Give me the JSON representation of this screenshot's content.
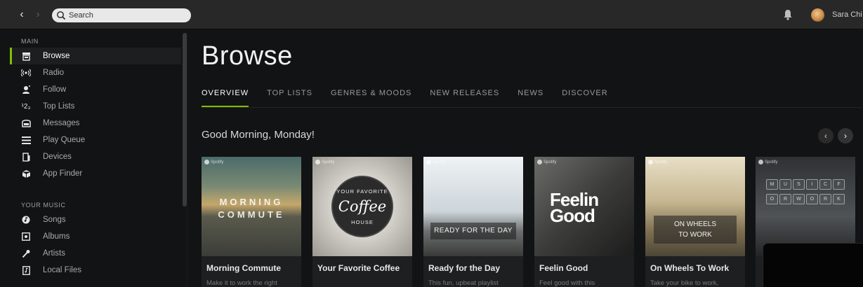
{
  "topbar": {
    "search_placeholder": "Search",
    "user_name": "Sara Chi"
  },
  "sidebar": {
    "main_label": "MAIN",
    "main_items": [
      {
        "label": "Browse",
        "icon": "browse-icon",
        "active": true
      },
      {
        "label": "Radio",
        "icon": "radio-icon"
      },
      {
        "label": "Follow",
        "icon": "follow-icon"
      },
      {
        "label": "Top Lists",
        "icon": "top-lists-icon"
      },
      {
        "label": "Messages",
        "icon": "messages-icon"
      },
      {
        "label": "Play Queue",
        "icon": "play-queue-icon"
      },
      {
        "label": "Devices",
        "icon": "devices-icon"
      },
      {
        "label": "App Finder",
        "icon": "app-finder-icon"
      }
    ],
    "music_label": "YOUR MUSIC",
    "music_items": [
      {
        "label": "Songs",
        "icon": "songs-icon"
      },
      {
        "label": "Albums",
        "icon": "albums-icon"
      },
      {
        "label": "Artists",
        "icon": "artists-icon"
      },
      {
        "label": "Local Files",
        "icon": "local-files-icon"
      }
    ]
  },
  "main": {
    "title": "Browse",
    "tabs": [
      {
        "label": "OVERVIEW",
        "active": true
      },
      {
        "label": "TOP LISTS"
      },
      {
        "label": "GENRES & MOODS"
      },
      {
        "label": "NEW RELEASES"
      },
      {
        "label": "NEWS"
      },
      {
        "label": "DISCOVER"
      }
    ],
    "section_title": "Good Morning, Monday!",
    "cards": [
      {
        "title": "Morning Commute",
        "desc": "Make it to work the right",
        "art_text": "MORNING COMMUTE",
        "brand": "Spotify"
      },
      {
        "title": "Your Favorite Coffee",
        "desc": "",
        "art_text_top": "YOUR FAVORITE",
        "art_text_big": "Coffee",
        "art_text_bottom": "HOUSE",
        "brand": "Spotify"
      },
      {
        "title": "Ready for the Day",
        "desc": "This fun, upbeat playlist",
        "art_text": "READY FOR THE DAY",
        "brand": "Spotify"
      },
      {
        "title": "Feelin Good",
        "desc": "Feel good with this",
        "art_text_1": "Feelin",
        "art_text_2": "Good",
        "brand": "Spotify"
      },
      {
        "title": "On Wheels To Work",
        "desc": "Take your bike to work,",
        "art_text_1": "ON WHEELS",
        "art_text_2": "TO WORK",
        "brand": "Spotify"
      },
      {
        "title": "",
        "desc": "",
        "keys": [
          "M",
          "U",
          "S",
          "I",
          "C",
          "F",
          "O",
          "R",
          "W",
          "O",
          "R",
          "K"
        ],
        "brand": "Spotify"
      }
    ]
  },
  "colors": {
    "accent": "#84bd00",
    "background": "#121314",
    "topbar": "#282828"
  }
}
